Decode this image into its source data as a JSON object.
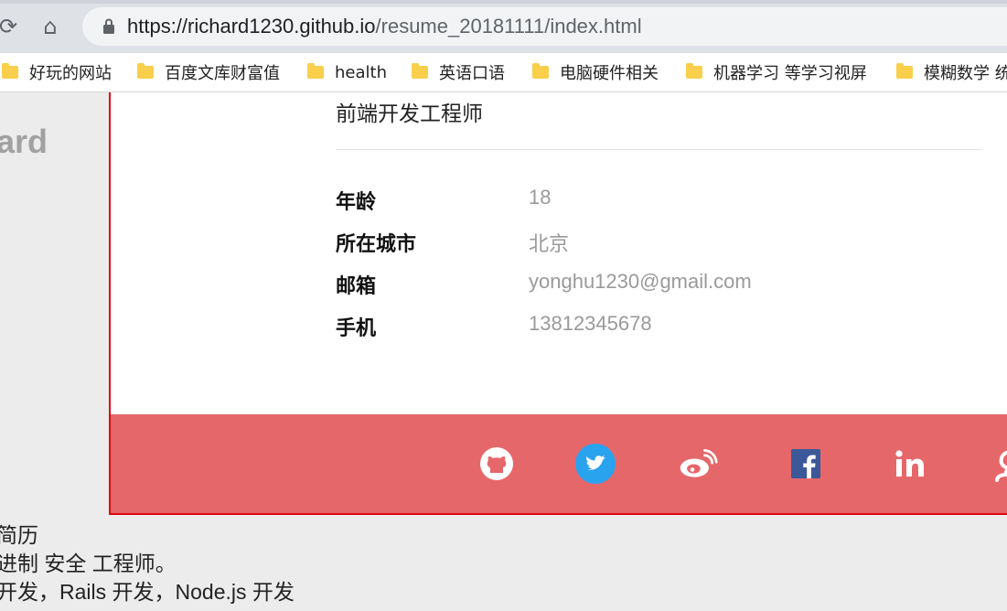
{
  "browser": {
    "url_host": "https://richard1230.github.io",
    "url_path": "/resume_20181111/index.html",
    "bookmarks": [
      {
        "label": "好玩的网站"
      },
      {
        "label": "百度文库财富值"
      },
      {
        "label": "health"
      },
      {
        "label": "英语口语"
      },
      {
        "label": "电脑硬件相关"
      },
      {
        "label": "机器学习 等学习视屏"
      },
      {
        "label": "模糊数学 统"
      }
    ]
  },
  "sidebar": {
    "name_fragment": "ard"
  },
  "card": {
    "job_title": "前端开发工程师",
    "info": [
      {
        "label": "年龄",
        "value": "18"
      },
      {
        "label": "所在城市",
        "value": "北京"
      },
      {
        "label": "邮箱",
        "value": "yonghu1230@gmail.com"
      },
      {
        "label": "手机",
        "value": "13812345678"
      }
    ],
    "social": [
      "github-icon",
      "twitter-icon",
      "weibo-icon",
      "facebook-icon",
      "linkedin-icon",
      "google-icon"
    ]
  },
  "below_text": [
    "简历",
    "进制 安全 工程师。",
    "开发，Rails 开发，Node.js 开发"
  ],
  "colors": {
    "footer": "#e6676a",
    "card_border": "#e1050e",
    "value_gray": "#9a9a9a"
  }
}
